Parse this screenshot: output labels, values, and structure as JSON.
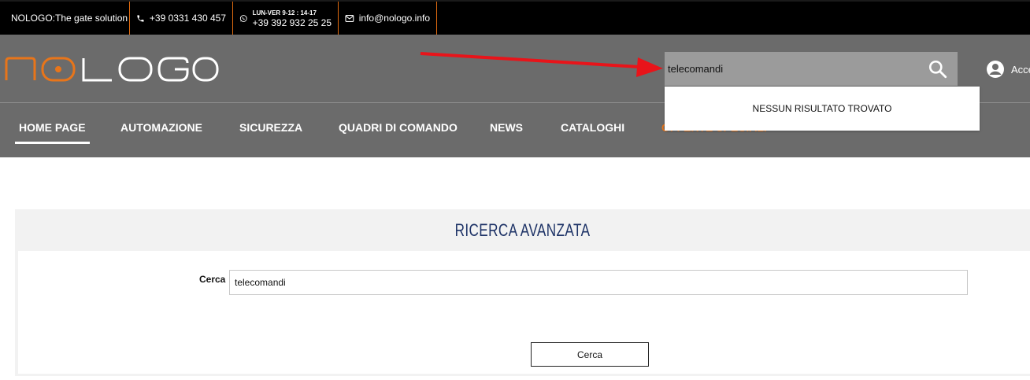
{
  "topbar": {
    "tagline": "NOLOGO:The gate solution",
    "phone": "+39 0331 430 457",
    "hours": "LUN-VER 9-12 : 14-17",
    "whatsapp": "+39 392 932 25 25",
    "email": "info@nologo.info",
    "icons": [
      "phone-icon",
      "whatsapp-icon",
      "mail-icon"
    ]
  },
  "header": {
    "logo_text": "NOLOGO",
    "search": {
      "value": "telecomandi",
      "placeholder": ""
    },
    "account_label": "Acce",
    "dropdown_text": "NESSUN RISULTATO TROVATO"
  },
  "nav": {
    "items": [
      {
        "label": "HOME PAGE"
      },
      {
        "label": "AUTOMAZIONE"
      },
      {
        "label": "SICUREZZA"
      },
      {
        "label": "QUADRI DI COMANDO"
      },
      {
        "label": "NEWS"
      },
      {
        "label": "CATALOGHI"
      },
      {
        "label": "OFFERTE SPECIALI"
      }
    ]
  },
  "advanced": {
    "title": "RICERCA AVANZATA",
    "label": "Cerca",
    "input_value": "telecomandi",
    "button": "Cerca"
  },
  "colors": {
    "accent": "#e8751a",
    "header_bg": "#6b6b6b",
    "title_blue": "#1e3367",
    "arrow": "#e8141a"
  }
}
